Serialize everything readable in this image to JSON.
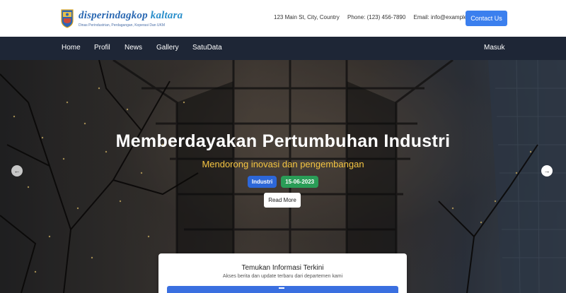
{
  "header": {
    "brand_main": "disperindagkop",
    "brand_accent": "kaltara",
    "brand_tagline": "Dinas Perindustrian, Perdagangan, Koperasi Dan UKM",
    "address": "123 Main St, City, Country",
    "phone": "Phone: (123) 456-7890",
    "email": "Email: info@example.com",
    "contact_button": "Contact Us"
  },
  "nav": {
    "items": [
      "Home",
      "Profil",
      "News",
      "Gallery",
      "SatuData"
    ],
    "login": "Masuk"
  },
  "hero": {
    "title": "Memberdayakan Pertumbuhan Industri",
    "subtitle": "Mendorong inovasi dan pengembangan",
    "category": "Industri",
    "date": "15-06-2023",
    "read_more": "Read More",
    "prev_icon": "arrow-left-icon",
    "next_icon": "arrow-right-icon"
  },
  "info_card": {
    "title": "Temukan Informasi Terkini",
    "description": "Akses berita dan update terbaru dari departemen kami"
  },
  "colors": {
    "accent": "#3b7fee",
    "nav_bg": "#1e2636",
    "subtitle": "#f5c542",
    "badge_category": "#2d67d8",
    "badge_date": "#2a9d57"
  }
}
